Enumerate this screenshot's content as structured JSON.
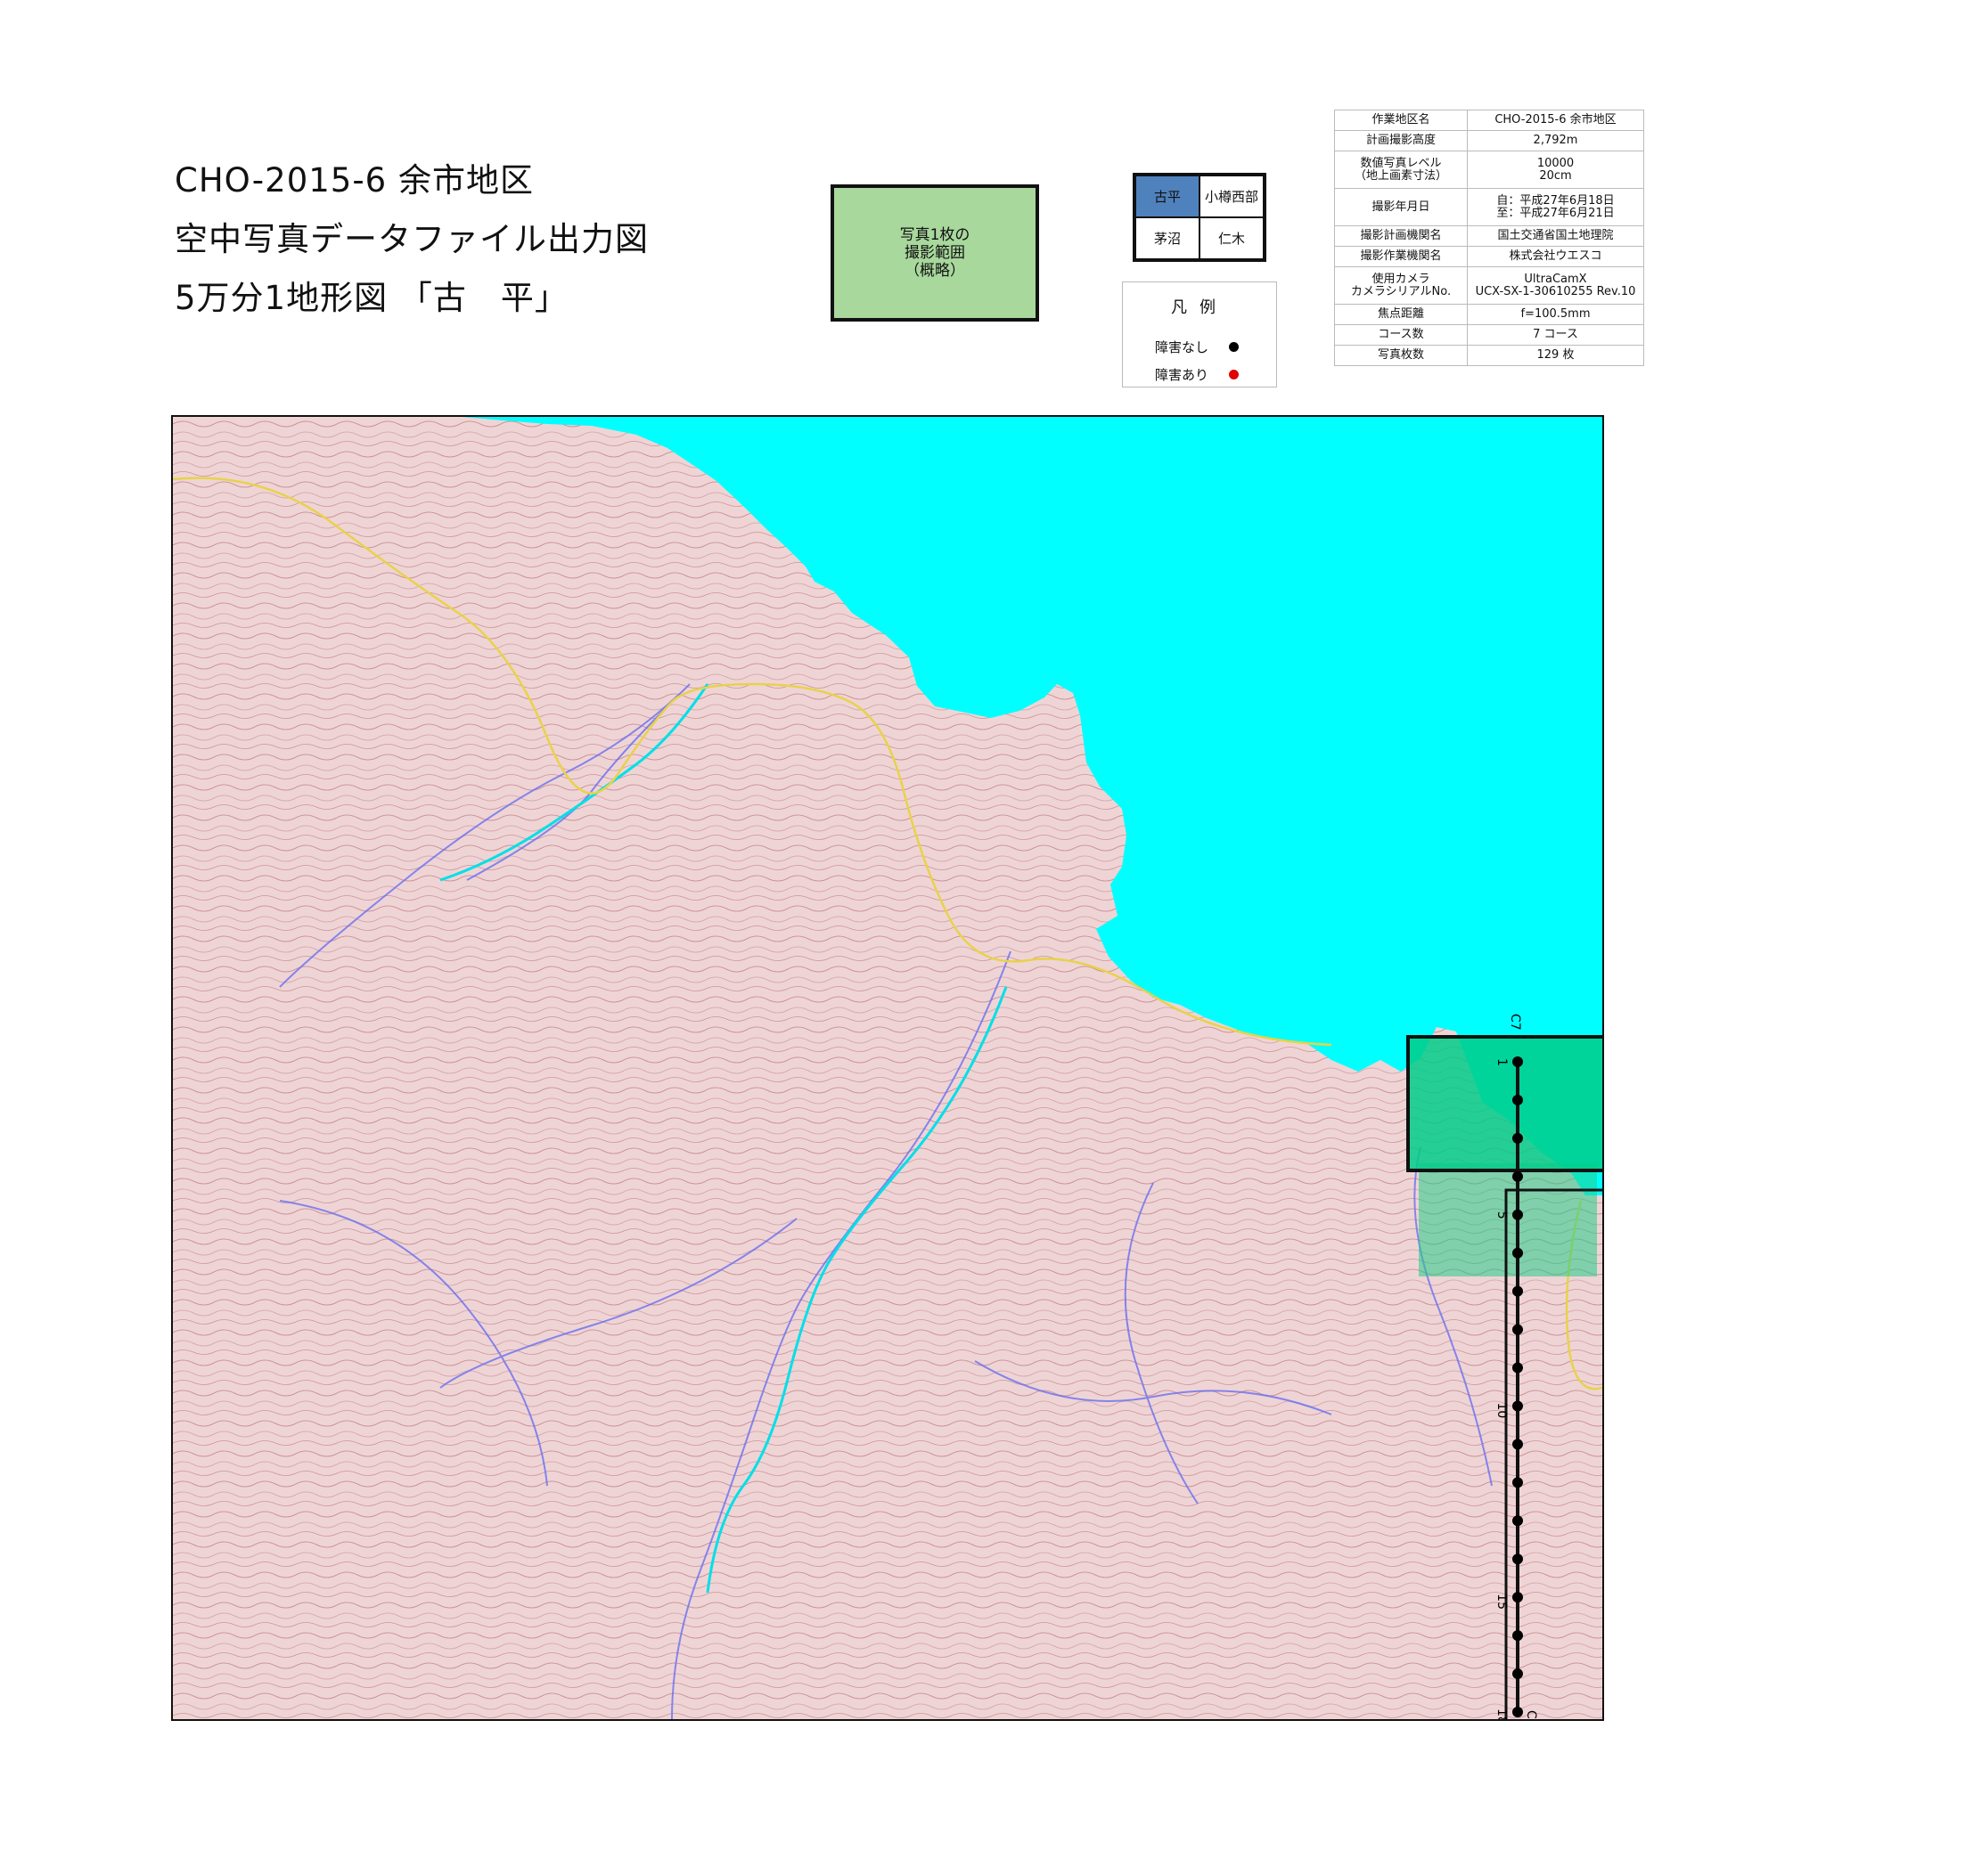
{
  "title": {
    "line1": "CHO-2015-6 余市地区",
    "line2": "空中写真データファイル出力図",
    "line3": "5万分1地形図 「古　平」"
  },
  "photo_box": {
    "lines": [
      "写真1枚の",
      "撮影範囲",
      "（概略）"
    ],
    "color": "#a8d89c"
  },
  "index_map": {
    "cells": [
      {
        "label": "古平",
        "active": true
      },
      {
        "label": "小樽西部",
        "active": false
      },
      {
        "label": "茅沼",
        "active": false
      },
      {
        "label": "仁木",
        "active": false
      }
    ],
    "active_color": "#4f81bd"
  },
  "legend": {
    "title": "凡例",
    "items": [
      {
        "label": "障害なし",
        "color": "#000000"
      },
      {
        "label": "障害あり",
        "color": "#e00000"
      }
    ]
  },
  "info_table": {
    "rows": [
      {
        "label": "作業地区名",
        "value": [
          "CHO-2015-6 余市地区"
        ]
      },
      {
        "label": "計画撮影高度",
        "value": [
          "2,792m"
        ]
      },
      {
        "label": [
          "数値写真レベル",
          "（地上画素寸法）"
        ],
        "value": [
          "10000",
          "20cm"
        ]
      },
      {
        "label": "撮影年月日",
        "value": [
          "自：平成27年6月18日",
          "至：平成27年6月21日"
        ]
      },
      {
        "label": "撮影計画機関名",
        "value": [
          "国土交通省国土地理院"
        ]
      },
      {
        "label": "撮影作業機関名",
        "value": [
          "株式会社ウエスコ"
        ]
      },
      {
        "label": [
          "使用カメラ",
          "カメラシリアルNo."
        ],
        "value": [
          "UltraCamX",
          "UCX-SX-1-30610255 Rev.10"
        ]
      },
      {
        "label": "焦点距離",
        "value": [
          "f=100.5mm"
        ]
      },
      {
        "label": "コース数",
        "value": [
          "7 コース"
        ]
      },
      {
        "label": "写真枚数",
        "value": [
          "129 枚"
        ]
      }
    ]
  },
  "map": {
    "sea_color": "#00ffff",
    "land_color": "#efd4d6",
    "photo_overlay_color": "#22cc88",
    "flight_course": {
      "course_label_top": "C7",
      "course_label_bottom": "C7",
      "photos_total": 18,
      "tick_labels": [
        "1",
        "5",
        "10",
        "15",
        "18"
      ],
      "obstruction_photos": []
    }
  }
}
